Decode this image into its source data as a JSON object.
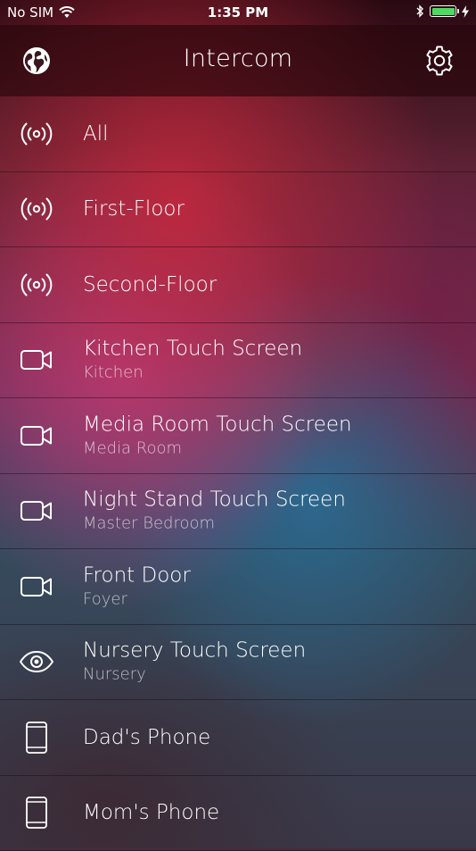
{
  "status_bar": {
    "carrier": "No SIM",
    "time": "1:35 PM",
    "battery_level": 1.0,
    "icons": [
      "wifi-icon",
      "bluetooth-icon",
      "battery-icon",
      "charging-icon"
    ]
  },
  "header": {
    "title": "Intercom",
    "left_icon": "globe-icon",
    "right_icon": "gear-icon"
  },
  "colors": {
    "battery_green": "#4cd964",
    "text_primary": "#ffffff"
  },
  "devices": [
    {
      "title": "All",
      "subtitle": "",
      "icon": "broadcast-icon"
    },
    {
      "title": "First-Floor",
      "subtitle": "",
      "icon": "broadcast-icon"
    },
    {
      "title": "Second-Floor",
      "subtitle": "",
      "icon": "broadcast-icon"
    },
    {
      "title": "Kitchen Touch Screen",
      "subtitle": "Kitchen",
      "icon": "video-camera-icon"
    },
    {
      "title": "Media Room Touch Screen",
      "subtitle": "Media Room",
      "icon": "video-camera-icon"
    },
    {
      "title": "Night Stand Touch Screen",
      "subtitle": "Master Bedroom",
      "icon": "video-camera-icon"
    },
    {
      "title": "Front Door",
      "subtitle": "Foyer",
      "icon": "video-camera-icon"
    },
    {
      "title": "Nursery Touch Screen",
      "subtitle": "Nursery",
      "icon": "eye-icon"
    },
    {
      "title": "Dad's Phone",
      "subtitle": "",
      "icon": "phone-icon"
    },
    {
      "title": "Mom's Phone",
      "subtitle": "",
      "icon": "phone-icon"
    }
  ]
}
